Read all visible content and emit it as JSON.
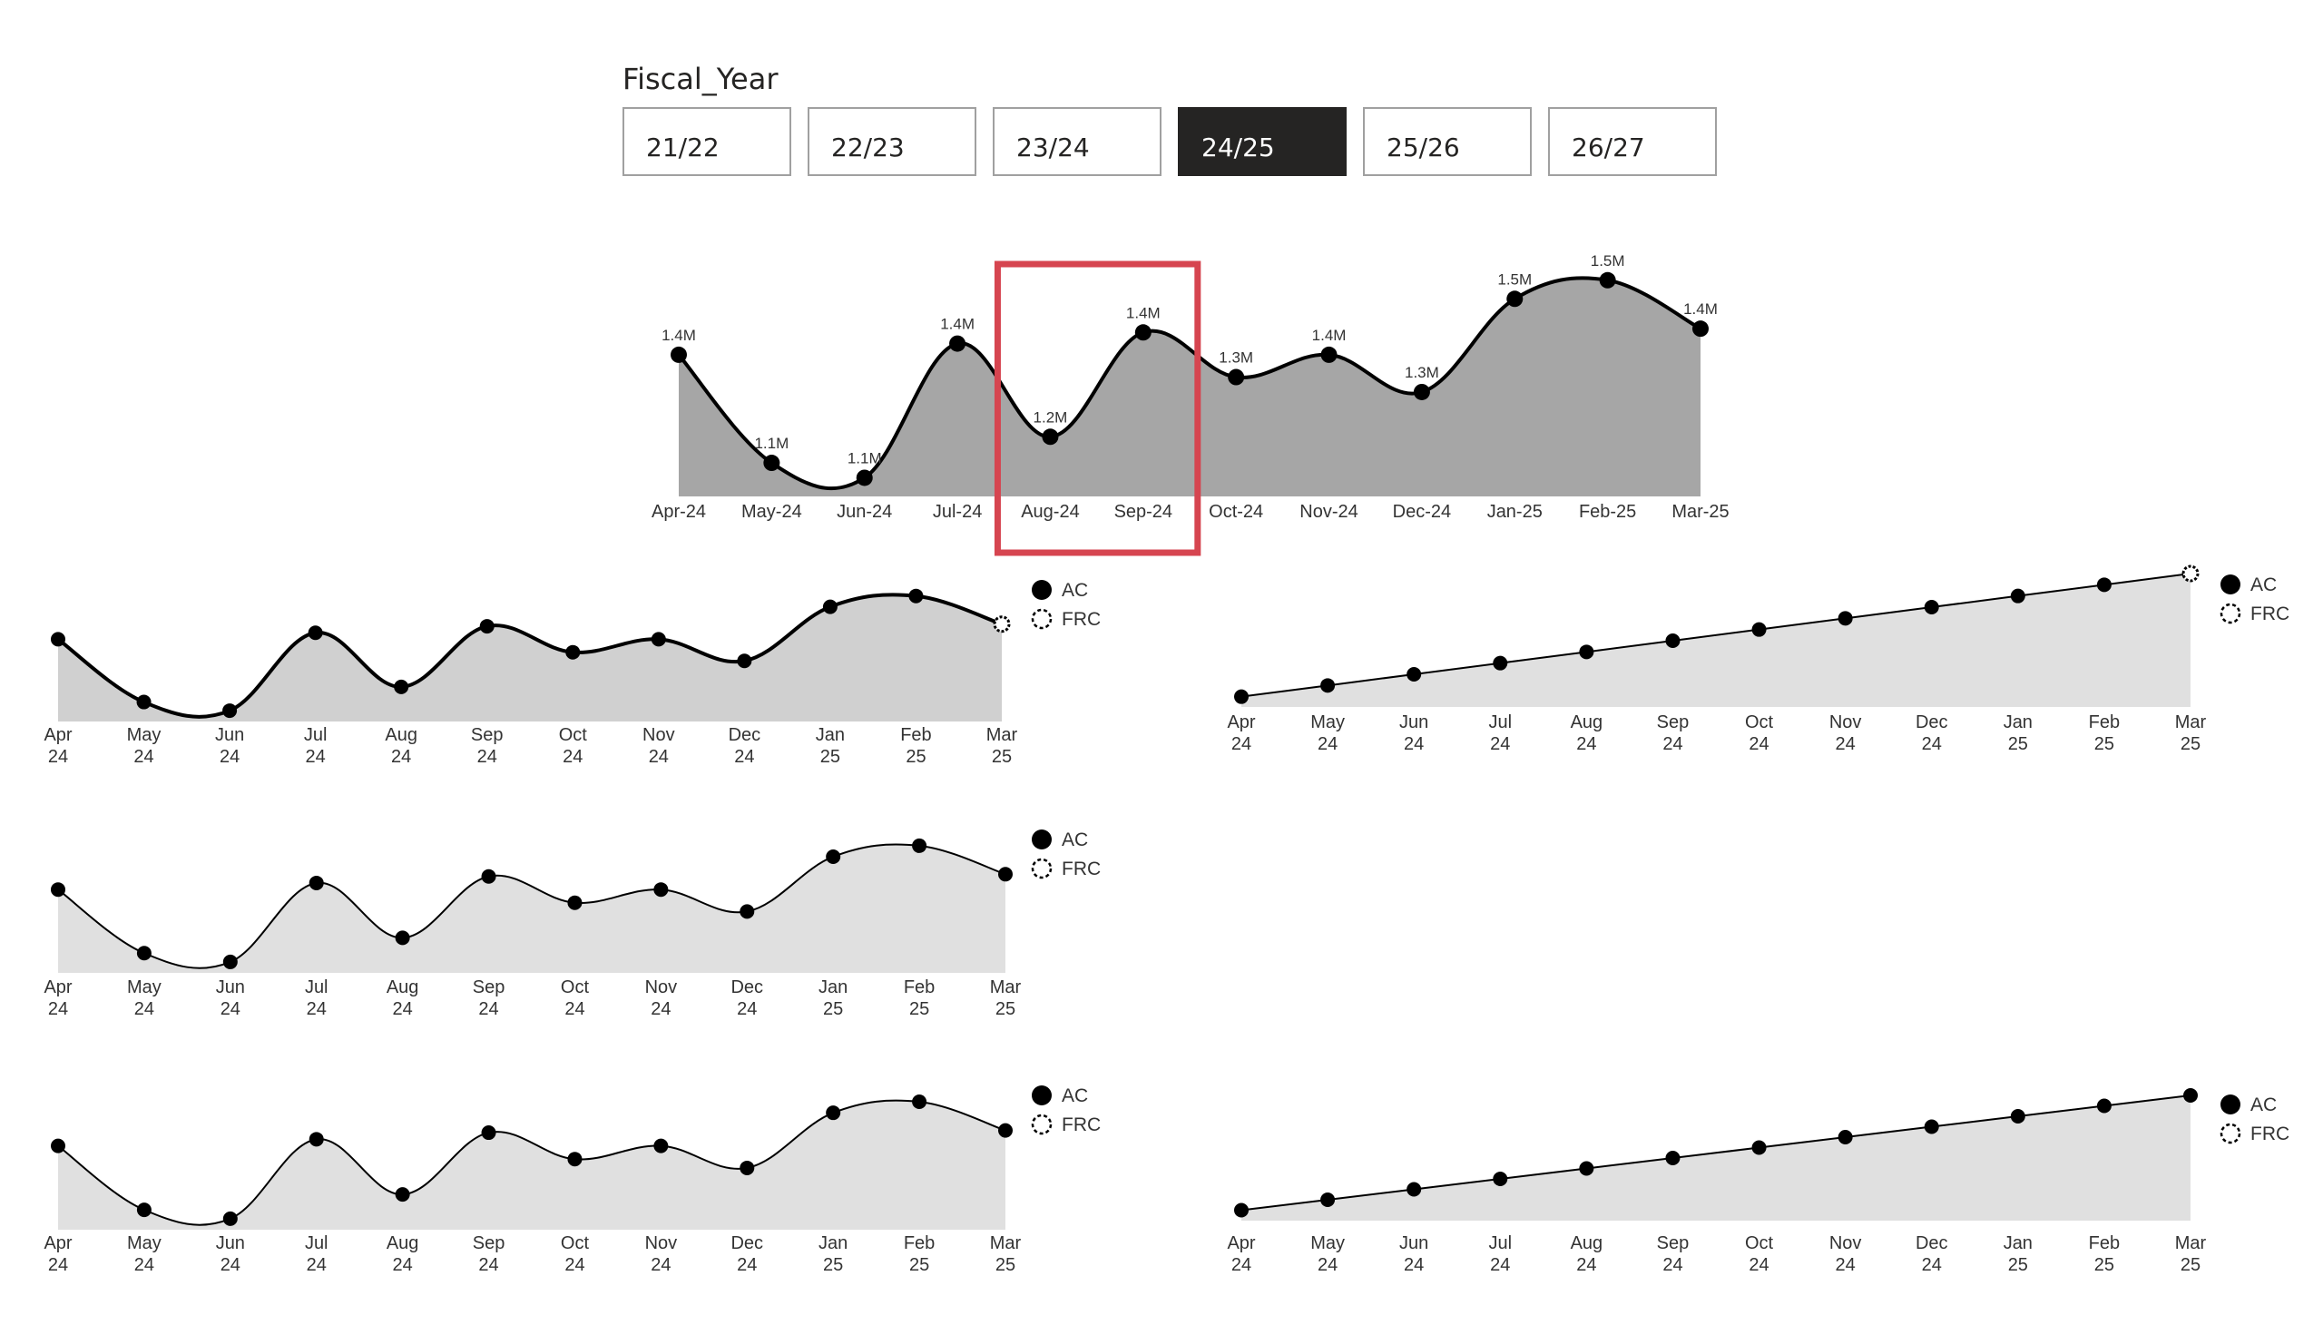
{
  "slicer": {
    "title": "Fiscal_Year",
    "options": [
      "21/22",
      "22/23",
      "23/24",
      "24/25",
      "25/26",
      "26/27"
    ],
    "selected": "24/25"
  },
  "colors": {
    "line": "#000000",
    "main_area": "#a6a6a6",
    "small_area_1": "#d0d0d0",
    "small_area_2": "#e0e0e0",
    "highlight_box": "#d64550"
  },
  "legend": {
    "ac": "AC",
    "frc": "FRC"
  },
  "chart_data": [
    {
      "type": "area",
      "categories": [
        "Apr-24",
        "May-24",
        "Jun-24",
        "Jul-24",
        "Aug-24",
        "Sep-24",
        "Oct-24",
        "Nov-24",
        "Dec-24",
        "Jan-25",
        "Feb-25",
        "Mar-25"
      ],
      "data_labels": [
        "1.4M",
        "1.1M",
        "1.1M",
        "1.4M",
        "1.2M",
        "1.4M",
        "1.3M",
        "1.4M",
        "1.3M",
        "1.5M",
        "1.5M",
        "1.4M"
      ],
      "values": [
        1.38,
        1.09,
        1.05,
        1.41,
        1.16,
        1.44,
        1.32,
        1.38,
        1.28,
        1.53,
        1.58,
        1.45
      ],
      "ylim": [
        1.0,
        1.65
      ],
      "highlight": [
        "Aug-24",
        "Sep-24"
      ],
      "grid": false
    },
    {
      "type": "area",
      "categories": [
        [
          "Apr",
          "24"
        ],
        [
          "May",
          "24"
        ],
        [
          "Jun",
          "24"
        ],
        [
          "Jul",
          "24"
        ],
        [
          "Aug",
          "24"
        ],
        [
          "Sep",
          "24"
        ],
        [
          "Oct",
          "24"
        ],
        [
          "Nov",
          "24"
        ],
        [
          "Dec",
          "24"
        ],
        [
          "Jan",
          "25"
        ],
        [
          "Feb",
          "25"
        ],
        [
          "Mar",
          "25"
        ]
      ],
      "values": [
        1.38,
        1.09,
        1.05,
        1.41,
        1.16,
        1.44,
        1.32,
        1.38,
        1.28,
        1.53,
        1.58,
        1.45
      ],
      "ylim": [
        1.0,
        1.65
      ],
      "forecast_index": 11,
      "legend": [
        "AC",
        "FRC"
      ]
    },
    {
      "type": "area",
      "categories": [
        [
          "Apr",
          "24"
        ],
        [
          "May",
          "24"
        ],
        [
          "Jun",
          "24"
        ],
        [
          "Jul",
          "24"
        ],
        [
          "Aug",
          "24"
        ],
        [
          "Sep",
          "24"
        ],
        [
          "Oct",
          "24"
        ],
        [
          "Nov",
          "24"
        ],
        [
          "Dec",
          "24"
        ],
        [
          "Jan",
          "25"
        ],
        [
          "Feb",
          "25"
        ],
        [
          "Mar",
          "25"
        ]
      ],
      "values": [
        1.38,
        1.09,
        1.05,
        1.41,
        1.16,
        1.44,
        1.32,
        1.38,
        1.28,
        1.53,
        1.58,
        1.45
      ],
      "ylim": [
        1.0,
        1.65
      ],
      "legend": [
        "AC",
        "FRC"
      ]
    },
    {
      "type": "area",
      "categories": [
        [
          "Apr",
          "24"
        ],
        [
          "May",
          "24"
        ],
        [
          "Jun",
          "24"
        ],
        [
          "Jul",
          "24"
        ],
        [
          "Aug",
          "24"
        ],
        [
          "Sep",
          "24"
        ],
        [
          "Oct",
          "24"
        ],
        [
          "Nov",
          "24"
        ],
        [
          "Dec",
          "24"
        ],
        [
          "Jan",
          "25"
        ],
        [
          "Feb",
          "25"
        ],
        [
          "Mar",
          "25"
        ]
      ],
      "values": [
        1.38,
        1.09,
        1.05,
        1.41,
        1.16,
        1.44,
        1.32,
        1.38,
        1.28,
        1.53,
        1.58,
        1.45
      ],
      "ylim": [
        1.0,
        1.65
      ],
      "legend": [
        "AC",
        "FRC"
      ]
    },
    {
      "type": "area",
      "categories": [
        [
          "Apr",
          "24"
        ],
        [
          "May",
          "24"
        ],
        [
          "Jun",
          "24"
        ],
        [
          "Jul",
          "24"
        ],
        [
          "Aug",
          "24"
        ],
        [
          "Sep",
          "24"
        ],
        [
          "Oct",
          "24"
        ],
        [
          "Nov",
          "24"
        ],
        [
          "Dec",
          "24"
        ],
        [
          "Jan",
          "25"
        ],
        [
          "Feb",
          "25"
        ],
        [
          "Mar",
          "25"
        ]
      ],
      "values": [
        1.38,
        2.76,
        4.14,
        5.52,
        6.9,
        8.28,
        9.66,
        11.04,
        12.42,
        13.8,
        15.18,
        16.56
      ],
      "ylim": [
        0,
        16.56
      ],
      "forecast_index": 11,
      "legend": [
        "AC",
        "FRC"
      ]
    },
    {
      "type": "area",
      "categories": [
        [
          "Apr",
          "24"
        ],
        [
          "May",
          "24"
        ],
        [
          "Jun",
          "24"
        ],
        [
          "Jul",
          "24"
        ],
        [
          "Aug",
          "24"
        ],
        [
          "Sep",
          "24"
        ],
        [
          "Oct",
          "24"
        ],
        [
          "Nov",
          "24"
        ],
        [
          "Dec",
          "24"
        ],
        [
          "Jan",
          "25"
        ],
        [
          "Feb",
          "25"
        ],
        [
          "Mar",
          "25"
        ]
      ],
      "values": [
        1.38,
        2.76,
        4.14,
        5.52,
        6.9,
        8.28,
        9.66,
        11.04,
        12.42,
        13.8,
        15.18,
        16.56
      ],
      "ylim": [
        0,
        16.56
      ],
      "legend": [
        "AC",
        "FRC"
      ]
    }
  ]
}
